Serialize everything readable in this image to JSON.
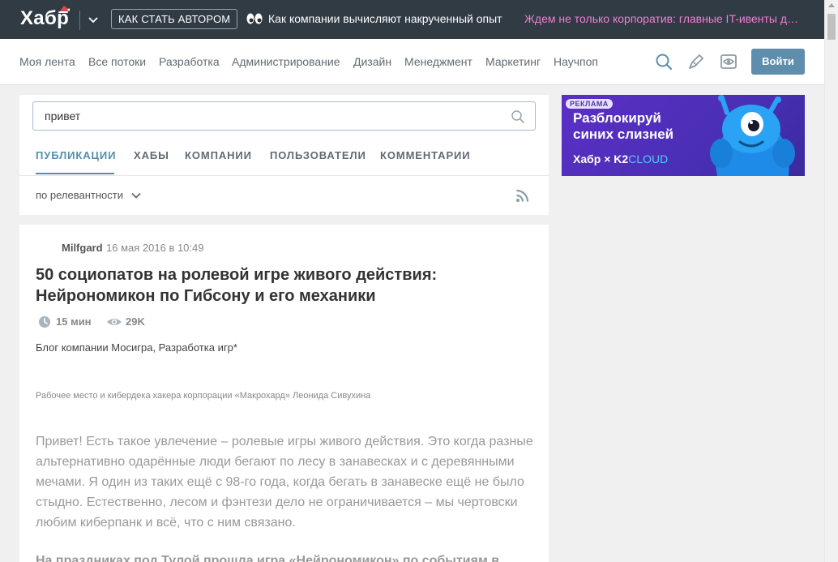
{
  "topbar": {
    "logo": "Хабр",
    "author_button": "Как стать автором",
    "headline": "Как компании вычисляют накрученный опыт",
    "promo": "Ждем не только корпоратив: главные IT-ивенты декабря"
  },
  "nav": {
    "items": [
      "Моя лента",
      "Все потоки",
      "Разработка",
      "Администрирование",
      "Дизайн",
      "Менеджмент",
      "Маркетинг",
      "Научпоп"
    ],
    "login": "Войти"
  },
  "search": {
    "value": "привет",
    "tabs": [
      "Публикации",
      "Хабы",
      "Компании",
      "Пользователи",
      "Комментарии"
    ],
    "active_tab": "Публикации",
    "sort": "по релевантности"
  },
  "article": {
    "author": "Milfgard",
    "date": "16 мая 2016 в 10:49",
    "title": "50 социопатов на ролевой игре живого действия: Нейрономикон по Гибсону и его механики",
    "read_time": "15 мин",
    "views": "29K",
    "hubs": "Блог компании Мосигра, Разработка игр*",
    "image_caption": "Рабочее место и кибердека хакера корпорации «Макрохард» Леонида Сивухина",
    "body": "Привет! Есть такое увлечение – ролевые игры живого действия. Это когда разные альтернативно одарённые люди бегают по лесу в занавесках и с деревянными мечами. Я один из таких ещё с 98-го года, когда бегать в занавеске ещё не было стыдно. Естественно, лесом и фэнтези дело не ограничивается – мы чертовски любим киберпанк и всё, что с ним связано.",
    "body_bold": "На праздниках под Тулой прошла игра «Нейрономикон» по событиям в"
  },
  "ad": {
    "badge": "Реклама",
    "line1": "Разблокируй",
    "line2": "синих слизней",
    "brand_habr": "Хабр",
    "brand_x": "×",
    "brand_k2": "K2",
    "brand_cloud": "CLOUD"
  },
  "colors": {
    "topbar_bg": "#303b44",
    "accent": "#548eaa",
    "login_bg": "#5e8eac",
    "promo": "#f07ed3"
  }
}
